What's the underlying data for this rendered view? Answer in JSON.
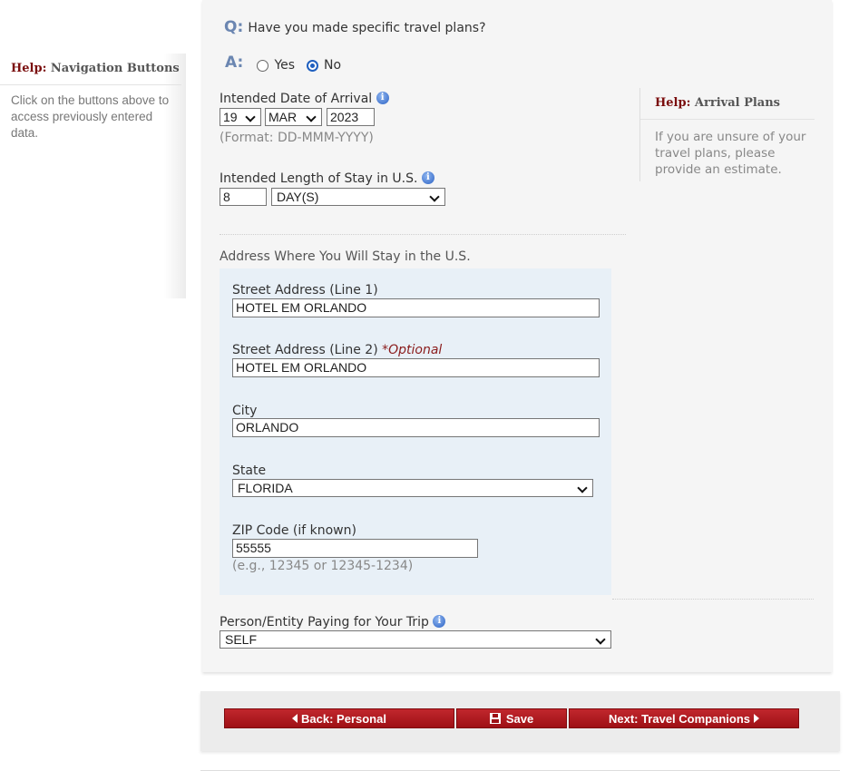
{
  "left_help": {
    "label": "Help:",
    "title": "Navigation Buttons",
    "body": "Click on the buttons above to access previously entered data."
  },
  "question": {
    "q_label": "Q:",
    "text": "Have you made specific travel plans?",
    "a_label": "A:",
    "yes_label": "Yes",
    "no_label": "No",
    "selected": "No"
  },
  "arrival": {
    "label": "Intended Date of Arrival",
    "day": "19",
    "month": "MAR",
    "year": "2023",
    "format_hint": "(Format: DD-MMM-YYYY)"
  },
  "stay": {
    "label": "Intended Length of Stay in U.S.",
    "value": "8",
    "unit": "DAY(S)"
  },
  "address": {
    "section_label": "Address Where You Will Stay in the U.S.",
    "street1_label": "Street Address (Line 1)",
    "street1_value": "HOTEL EM ORLANDO",
    "street2_label": "Street Address (Line 2)",
    "street2_optional": "*Optional",
    "street2_value": "HOTEL EM ORLANDO",
    "city_label": "City",
    "city_value": "ORLANDO",
    "state_label": "State",
    "state_value": "FLORIDA",
    "zip_label": "ZIP Code (if known)",
    "zip_value": "55555",
    "zip_hint": "(e.g., 12345 or 12345-1234)"
  },
  "payer": {
    "label": "Person/Entity Paying for Your Trip",
    "value": "SELF"
  },
  "right_help": {
    "label": "Help:",
    "title": "Arrival Plans",
    "body": "If you are unsure of your travel plans, please provide an estimate."
  },
  "nav": {
    "back_label": "Back: Personal",
    "save_label": "Save",
    "next_label": "Next: Travel Companions"
  },
  "colors": {
    "button_red": "#b01c22",
    "question_blue": "#6b86b1",
    "help_title_red": "#7a0c0c",
    "address_bg": "#e8f0f7"
  }
}
